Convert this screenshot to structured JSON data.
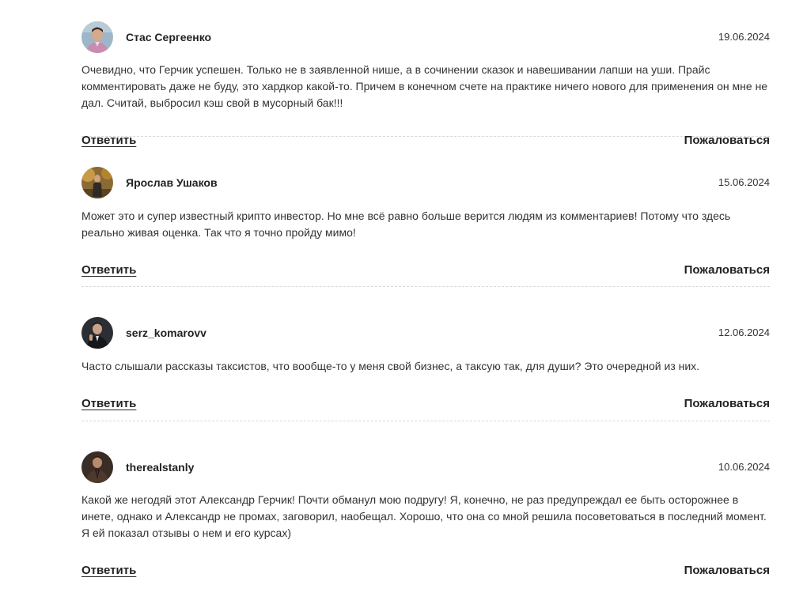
{
  "comments": [
    {
      "author": "Стас Сергеенко",
      "date": "19.06.2024",
      "text": "Очевидно, что Герчик успешен. Только не в заявленной нише, а в сочинении сказок и навешивании лапши на уши. Прайс комментировать даже не буду, это хардкор какой-то. Причем в конечном счете на практике ничего нового для применения он мне не дал. Считай, выбросил кэш свой в мусорный бак!!!",
      "reply_label": "Ответить",
      "report_label": "Пожаловаться"
    },
    {
      "author": "Ярослав Ушаков",
      "date": "15.06.2024",
      "text": "Может это и супер известный крипто инвестор. Но мне всё равно больше верится людям из комментариев! Потому что здесь реально живая оценка. Так что я точно пройду мимо!",
      "reply_label": "Ответить",
      "report_label": "Пожаловаться"
    },
    {
      "author": "serz_komarovv",
      "date": "12.06.2024",
      "text": "Часто слышали рассказы таксистов, что вообще-то у меня свой бизнес, а таксую так, для души? Это очередной из них.",
      "reply_label": "Ответить",
      "report_label": "Пожаловаться"
    },
    {
      "author": "therealstanly",
      "date": "10.06.2024",
      "text": "Какой же негодяй этот Александр Герчик! Почти обманул мою подругу! Я, конечно, не раз предупреждал ее быть осторожнее в инете, однако и Александр не промах, заговорил, наобещал. Хорошо, что она со мной решила посоветоваться в последний момент. Я ей показал отзывы о нем и его курсах)",
      "reply_label": "Ответить",
      "report_label": "Пожаловаться"
    }
  ],
  "colors": {
    "text": "#222222",
    "separator": "#d8d8d8",
    "background": "#ffffff"
  }
}
